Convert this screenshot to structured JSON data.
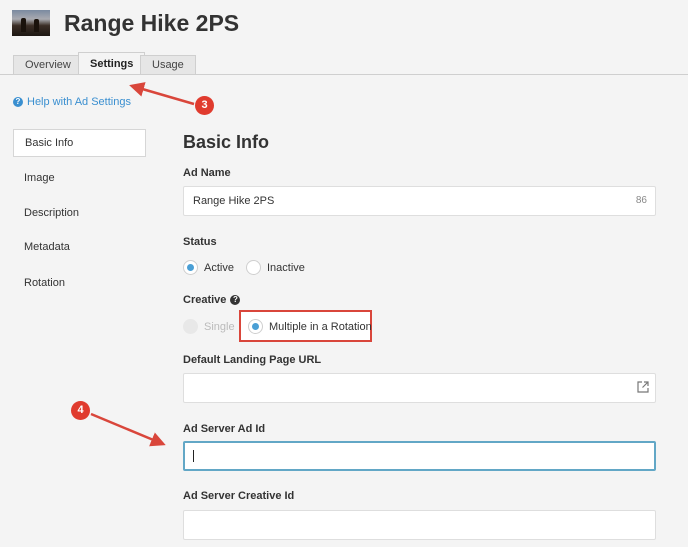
{
  "header": {
    "title": "Range Hike 2PS"
  },
  "tabs": [
    {
      "label": "Overview"
    },
    {
      "label": "Settings"
    },
    {
      "label": "Usage"
    }
  ],
  "help": {
    "label": "Help with Ad Settings"
  },
  "sidebar": {
    "items": [
      {
        "label": "Basic Info"
      },
      {
        "label": "Image"
      },
      {
        "label": "Description"
      },
      {
        "label": "Metadata"
      },
      {
        "label": "Rotation"
      }
    ]
  },
  "form": {
    "section_title": "Basic Info",
    "ad_name": {
      "label": "Ad Name",
      "value": "Range Hike 2PS",
      "counter": "86"
    },
    "status": {
      "label": "Status",
      "options": [
        "Active",
        "Inactive"
      ],
      "selected": "Active"
    },
    "creative": {
      "label": "Creative",
      "options": [
        "Single",
        "Multiple in a Rotation"
      ],
      "selected": "Multiple in a Rotation"
    },
    "landing_url": {
      "label": "Default Landing Page URL",
      "value": ""
    },
    "ad_server_ad_id": {
      "label": "Ad Server Ad Id",
      "value": ""
    },
    "ad_server_creative_id": {
      "label": "Ad Server Creative Id",
      "value": ""
    }
  },
  "annotations": {
    "step_3": "3",
    "step_4": "4",
    "color": "#e03b2e"
  }
}
